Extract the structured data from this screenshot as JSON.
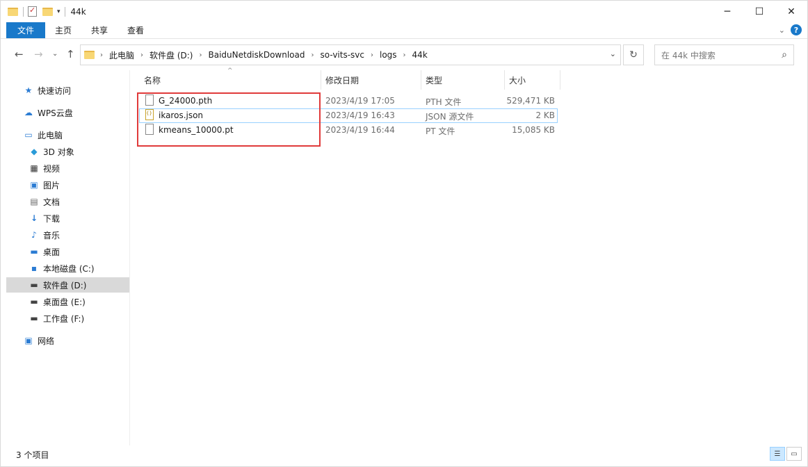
{
  "window": {
    "title": "44k",
    "controls": {
      "minimize": "─",
      "maximize": "☐",
      "close": "✕"
    }
  },
  "ribbon": {
    "tabs": [
      "文件",
      "主页",
      "共享",
      "查看"
    ],
    "help": "?"
  },
  "address": {
    "crumbs": [
      "此电脑",
      "软件盘 (D:)",
      "BaiduNetdiskDownload",
      "so-vits-svc",
      "logs",
      "44k"
    ]
  },
  "search": {
    "placeholder": "在 44k 中搜索"
  },
  "nav": {
    "quick_access": "快速访问",
    "wps": "WPS云盘",
    "this_pc": "此电脑",
    "objects3d": "3D 对象",
    "videos": "视频",
    "pictures": "图片",
    "documents": "文档",
    "downloads": "下载",
    "music": "音乐",
    "desktop": "桌面",
    "drive_c": "本地磁盘 (C:)",
    "drive_d": "软件盘 (D:)",
    "drive_e": "桌面盘 (E:)",
    "drive_f": "工作盘 (F:)",
    "network": "网络"
  },
  "columns": {
    "name": "名称",
    "modified": "修改日期",
    "type": "类型",
    "size": "大小"
  },
  "files": [
    {
      "name": "G_24000.pth",
      "modified": "2023/4/19 17:05",
      "type": "PTH 文件",
      "size": "529,471 KB"
    },
    {
      "name": "ikaros.json",
      "modified": "2023/4/19 16:43",
      "type": "JSON 源文件",
      "size": "2 KB"
    },
    {
      "name": "kmeans_10000.pt",
      "modified": "2023/4/19 16:44",
      "type": "PT 文件",
      "size": "15,085 KB"
    }
  ],
  "status": {
    "count": "3 个项目"
  },
  "colors": {
    "accent": "#1979ca",
    "highlight_box": "#e03a3a",
    "selection": "#d9d9d9"
  }
}
